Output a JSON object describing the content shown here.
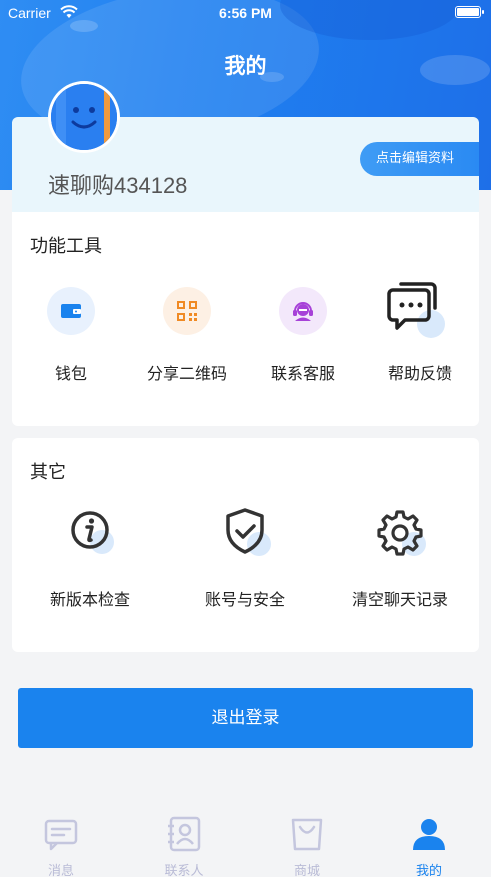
{
  "status_bar": {
    "carrier": "Carrier",
    "time": "6:56 PM"
  },
  "nav": {
    "title": "我的"
  },
  "profile": {
    "username": "速聊购434128",
    "edit_label": "点击编辑资料"
  },
  "tools": {
    "title": "功能工具",
    "items": [
      {
        "label": "钱包",
        "icon": "wallet-icon"
      },
      {
        "label": "分享二维码",
        "icon": "qrcode-icon"
      },
      {
        "label": "联系客服",
        "icon": "customer-service-icon"
      },
      {
        "label": "帮助反馈",
        "icon": "feedback-chat-icon"
      }
    ]
  },
  "other": {
    "title": "其它",
    "items": [
      {
        "label": "新版本检查",
        "icon": "info-icon"
      },
      {
        "label": "账号与安全",
        "icon": "shield-check-icon"
      },
      {
        "label": "清空聊天记录",
        "icon": "gear-icon"
      }
    ]
  },
  "logout": {
    "label": "退出登录"
  },
  "tabbar": {
    "items": [
      {
        "label": "消息",
        "icon": "message-icon"
      },
      {
        "label": "联系人",
        "icon": "contacts-icon"
      },
      {
        "label": "商城",
        "icon": "shopping-bag-icon"
      },
      {
        "label": "我的",
        "icon": "user-icon",
        "active": true
      }
    ]
  },
  "colors": {
    "primary": "#1a83ee",
    "tab_inactive": "#b9bbd6"
  }
}
